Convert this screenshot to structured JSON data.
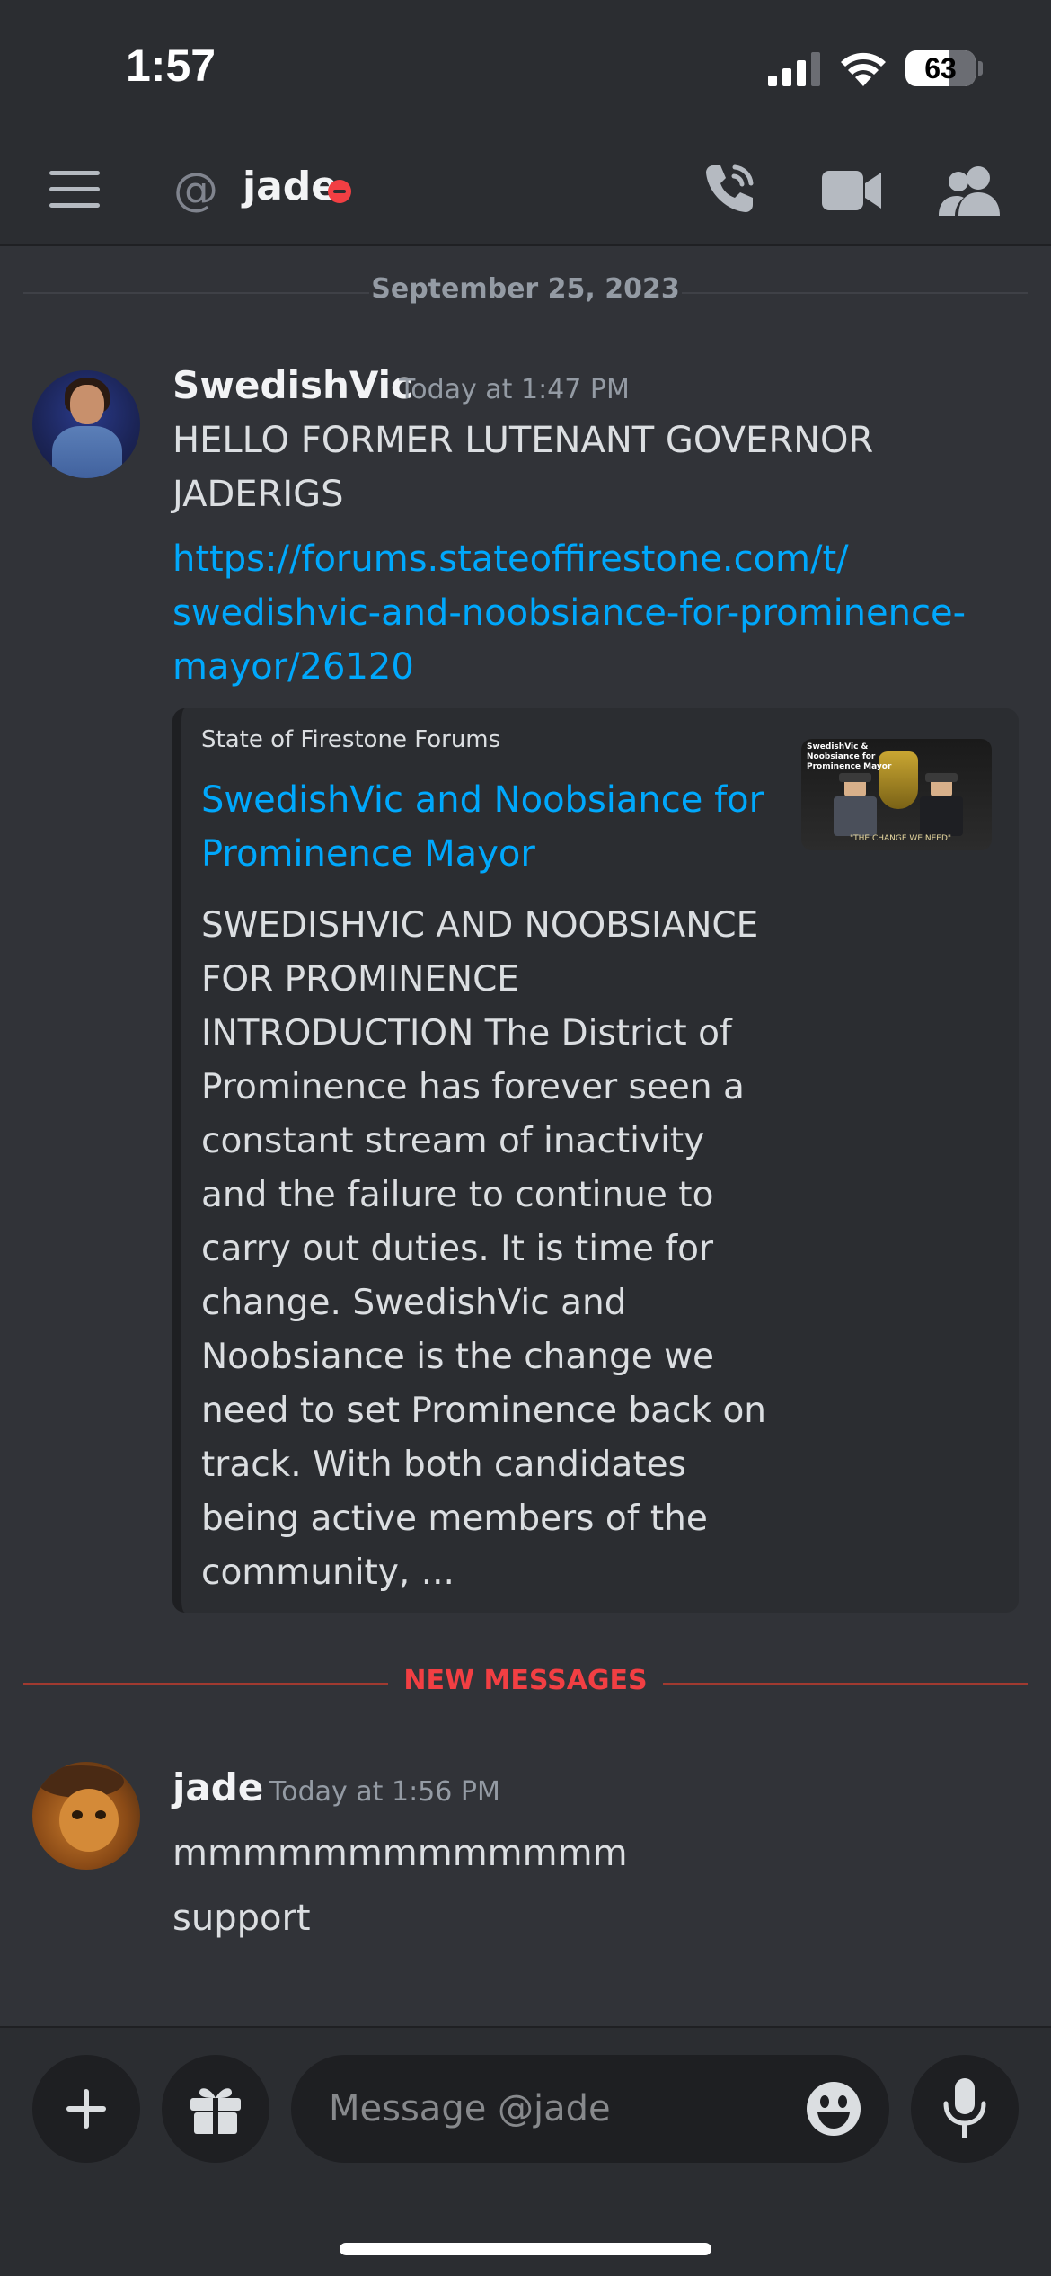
{
  "status_bar": {
    "time": "1:57",
    "battery": "63"
  },
  "header": {
    "at_symbol": "@",
    "name": "jade",
    "status": "do-not-disturb"
  },
  "date_divider": "September 25, 2023",
  "messages": [
    {
      "username": "SwedishVic",
      "timestamp": "Today at 1:47 PM",
      "text_lines": [
        "HELLO FORMER LUTENANT GOVERNOR",
        "JADERIGS"
      ],
      "link_lines": [
        "https://forums.stateoffirestone.com/t/",
        "swedishvic-and-noobsiance-for-prominence-",
        "mayor/26120"
      ],
      "embed": {
        "provider": "State of Firestone Forums",
        "title_lines": [
          "SwedishVic and Noobsiance for",
          "Prominence Mayor"
        ],
        "description_lines": [
          "SWEDISHVIC AND NOOBSIANCE",
          "FOR PROMINENCE",
          "INTRODUCTION  The District of",
          "Prominence has forever seen a",
          "constant stream of inactivity",
          "and the failure to continue to",
          "carry out duties. It is time for",
          "change. SwedishVic and",
          "Noobsiance is the change we",
          "need to set Prominence back on",
          "track. With both candidates",
          "being active members of the",
          "community, ..."
        ],
        "thumbnail_caption": "SwedishVic & Noobsiance for Prominence Mayor",
        "thumbnail_footer": "\"THE CHANGE WE NEED\""
      }
    },
    {
      "username": "jade",
      "timestamp": "Today at 1:56 PM",
      "text_lines": [
        "mmmmmmmmmmmmm",
        "support"
      ]
    }
  ],
  "new_messages_label": "NEW MESSAGES",
  "composer": {
    "placeholder": "Message @jade"
  },
  "icons": {
    "menu": "hamburger-icon",
    "call": "phone-call-icon",
    "video": "video-camera-icon",
    "members": "members-icon",
    "plus": "plus-icon",
    "gift": "gift-icon",
    "emoji": "emoji-icon",
    "mic": "microphone-icon"
  },
  "colors": {
    "background": "#313338",
    "header": "#2b2d31",
    "link": "#00a8fc",
    "new_messages": "#f23f43",
    "dnd": "#f23f43"
  }
}
